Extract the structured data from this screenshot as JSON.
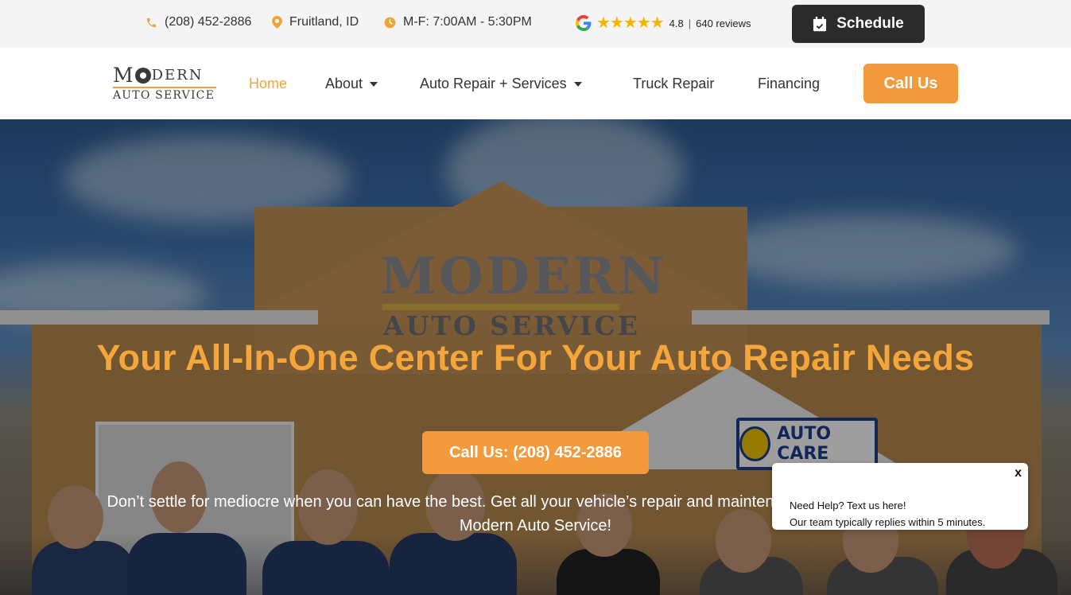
{
  "topbar": {
    "phone": "(208) 452-2886",
    "location": "Fruitland, ID",
    "hours": "M-F: 7:00AM - 5:30PM",
    "rating_stars": "★★★★★",
    "rating_value": "4.8",
    "rating_sep": "|",
    "reviews": "640 reviews",
    "schedule_label": "Schedule",
    "accent_color": "#f0a437"
  },
  "logo": {
    "line1_start": "M",
    "line1_end": "DERN",
    "line2": "AUTO SERVICE"
  },
  "nav": {
    "home": "Home",
    "about": "About",
    "auto_repair": "Auto Repair + Services",
    "truck_repair": "Truck Repair",
    "financing": "Financing",
    "call_us": "Call Us"
  },
  "hero": {
    "title": "Your All-In-One Center For Your Auto Repair Needs",
    "cta": "Call Us: (208) 452-2886",
    "subtitle": "Don’t settle for mediocre when you can have the best. Get all your vehicle’s repair and maintenance needs in one place at Modern Auto Service!",
    "sign_line1": "MODERN",
    "sign_line2": "AUTO SERVICE",
    "napa_label": "AUTO CARE"
  },
  "chat": {
    "close": "x",
    "line1": "Need Help? Text us here!",
    "line2": "Our team typically replies within 5 minutes."
  }
}
